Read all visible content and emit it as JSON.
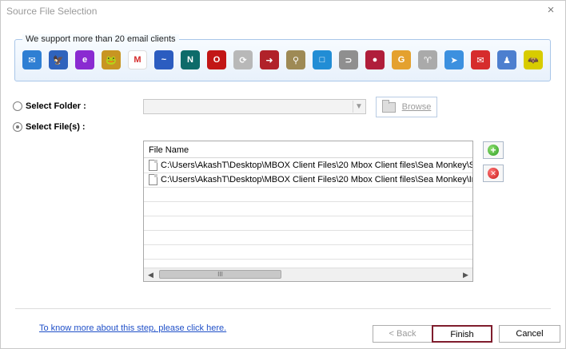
{
  "window": {
    "title": "Source File Selection",
    "close_icon": "×"
  },
  "clients": {
    "caption": "We support more than 20 email clients",
    "icons": [
      {
        "name": "mail",
        "color": "#2f7fd3",
        "glyph": "✉"
      },
      {
        "name": "thunderbird",
        "color": "#2f63bd",
        "glyph": "🦅"
      },
      {
        "name": "eudora",
        "color": "#8a2bd1",
        "glyph": "e"
      },
      {
        "name": "pocomail",
        "color": "#c89522",
        "glyph": "🐸"
      },
      {
        "name": "gmail",
        "color": "#ffffff",
        "glyph": "M"
      },
      {
        "name": "seamonkey",
        "color": "#2b5cc0",
        "glyph": "~"
      },
      {
        "name": "netscape",
        "color": "#0e6b6a",
        "glyph": "N"
      },
      {
        "name": "opera",
        "color": "#c21616",
        "glyph": "O"
      },
      {
        "name": "mail-sync",
        "color": "#b8b8b8",
        "glyph": "⟳"
      },
      {
        "name": "mailbox-arrow",
        "color": "#b1222a",
        "glyph": "➜"
      },
      {
        "name": "sylpheed",
        "color": "#9e8a55",
        "glyph": "⚲"
      },
      {
        "name": "postbox",
        "color": "#218dd5",
        "glyph": "□"
      },
      {
        "name": "gnome-evolution",
        "color": "#8f8f8f",
        "glyph": "⊃"
      },
      {
        "name": "claws",
        "color": "#b01e3b",
        "glyph": "●"
      },
      {
        "name": "g-mail",
        "color": "#e4a12f",
        "glyph": "G"
      },
      {
        "name": "gnu",
        "color": "#aaaaaa",
        "glyph": "♈"
      },
      {
        "name": "spicebird",
        "color": "#3c90df",
        "glyph": "➤"
      },
      {
        "name": "mail-envelope",
        "color": "#d62c2c",
        "glyph": "✉"
      },
      {
        "name": "mulberry",
        "color": "#4d7fcf",
        "glyph": "♟"
      },
      {
        "name": "the-bat",
        "color": "#d8cc00",
        "glyph": "🦇"
      }
    ]
  },
  "options": {
    "folder_label": "Select Folder :",
    "files_label": "Select File(s) :",
    "selected": "files"
  },
  "browse": {
    "label": "Browse"
  },
  "file_list": {
    "column": "File Name",
    "rows": [
      "C:\\Users\\AkashT\\Desktop\\MBOX Client Files\\20 Mbox Client files\\Sea Monkey\\S",
      "C:\\Users\\AkashT\\Desktop\\MBOX Client Files\\20 Mbox Client files\\Sea Monkey\\In"
    ],
    "scroll_left": "◀",
    "scroll_right": "▶",
    "thumb_grip": "III"
  },
  "actions": {
    "add_icon": "+",
    "remove_icon": "✕"
  },
  "footer": {
    "help_link": "To know more about this step, please click here.",
    "back": "< Back",
    "finish": "Finish",
    "cancel": "Cancel"
  }
}
